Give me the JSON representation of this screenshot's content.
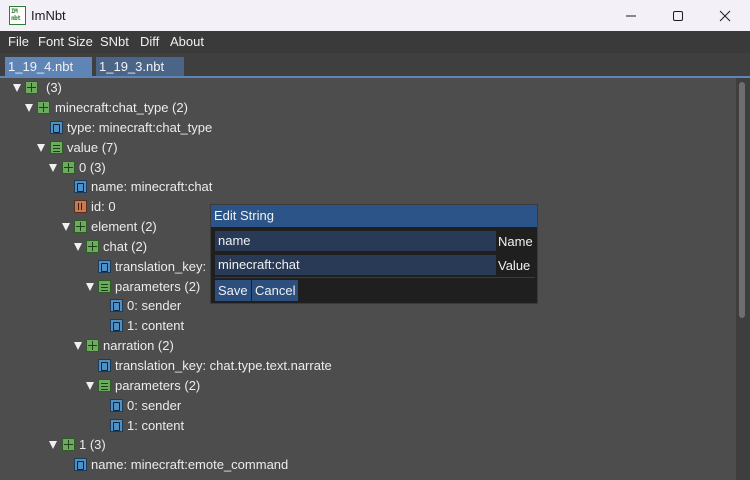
{
  "window": {
    "title": "ImNbt",
    "logo_text_top": "IM",
    "logo_text_bottom": "nbt",
    "minimize_icon": "minimize-icon",
    "maximize_icon": "maximize-icon",
    "close_icon": "close-icon"
  },
  "menu": [
    "File",
    "Font Size",
    "SNbt",
    "Diff",
    "About"
  ],
  "tabs": [
    "1_19_4.nbt",
    "1_19_3.nbt"
  ],
  "tree": [
    {
      "label": "(3)",
      "type": "compound",
      "expanded": true
    },
    {
      "label": "minecraft:chat_type (2)",
      "type": "compound",
      "expanded": true
    },
    {
      "label": "type: minecraft:chat_type",
      "type": "string"
    },
    {
      "label": "value (7)",
      "type": "list",
      "expanded": true
    },
    {
      "label": "0 (3)",
      "type": "compound",
      "expanded": true
    },
    {
      "label": "name: minecraft:chat",
      "type": "string"
    },
    {
      "label": "id: 0",
      "type": "int"
    },
    {
      "label": "element (2)",
      "type": "compound",
      "expanded": true
    },
    {
      "label": "chat (2)",
      "type": "compound",
      "expanded": true
    },
    {
      "label": "translation_key: chat.type.text",
      "type": "string"
    },
    {
      "label": "parameters (2)",
      "type": "list",
      "expanded": true
    },
    {
      "label": "0: sender",
      "type": "string"
    },
    {
      "label": "1: content",
      "type": "string"
    },
    {
      "label": "narration (2)",
      "type": "compound",
      "expanded": true
    },
    {
      "label": "translation_key: chat.type.text.narrate",
      "type": "string"
    },
    {
      "label": "parameters (2)",
      "type": "list",
      "expanded": true
    },
    {
      "label": "0: sender",
      "type": "string"
    },
    {
      "label": "1: content",
      "type": "string"
    },
    {
      "label": "1 (3)",
      "type": "compound",
      "expanded": true
    },
    {
      "label": "name: minecraft:emote_command",
      "type": "string"
    }
  ],
  "dialog": {
    "title": "Edit String",
    "name_value": "name",
    "name_label": "Name",
    "value_value": "minecraft:chat",
    "value_label": "Value",
    "save_label": "Save",
    "cancel_label": "Cancel"
  },
  "colors": {
    "accent": "#5f85b7",
    "dialog_title": "#2d5489",
    "compound_icon": "#6cab5d",
    "string_icon": "#4d90c5",
    "int_icon": "#c47a55"
  }
}
